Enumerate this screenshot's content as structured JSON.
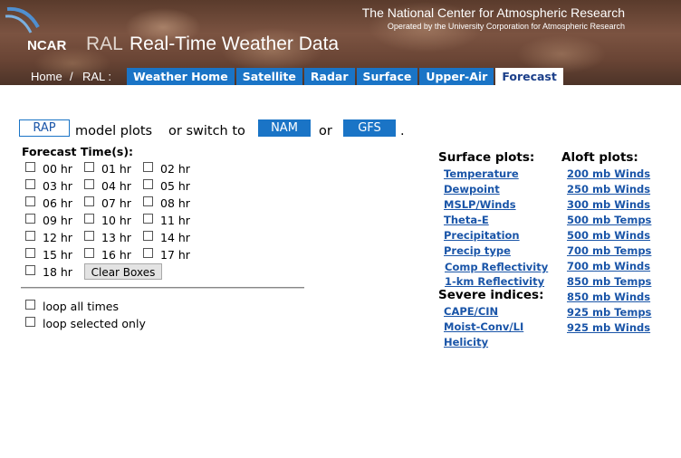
{
  "header": {
    "logo_text": "NCAR",
    "ral_text": "RAL",
    "site_title": "Real-Time Weather Data",
    "org_name": "The National Center for Atmospheric Research",
    "org_sub": "Operated by the University Corporation for Atmospheric Research",
    "breadcrumb_home": "Home",
    "breadcrumb_sep": "/",
    "breadcrumb_ral": "RAL :"
  },
  "nav": {
    "tabs": [
      {
        "label": "Weather Home"
      },
      {
        "label": "Satellite"
      },
      {
        "label": "Radar"
      },
      {
        "label": "Surface"
      },
      {
        "label": "Upper-Air"
      },
      {
        "label": "Forecast",
        "active": true
      }
    ]
  },
  "model_switch": {
    "current": "RAP",
    "text_model_plots": "model plots",
    "text_or_switch": "or switch to",
    "alt1": "NAM",
    "text_or": "or",
    "alt2": "GFS",
    "period": "."
  },
  "forecast": {
    "label": "Forecast Time(s):",
    "hours": [
      "00 hr",
      "01 hr",
      "02 hr",
      "03 hr",
      "04 hr",
      "05 hr",
      "06 hr",
      "07 hr",
      "08 hr",
      "09 hr",
      "10 hr",
      "11 hr",
      "12 hr",
      "13 hr",
      "14 hr",
      "15 hr",
      "16 hr",
      "17 hr",
      "18 hr"
    ],
    "clear_button": "Clear Boxes",
    "loop_all": "loop all times",
    "loop_selected": "loop selected only"
  },
  "surface": {
    "heading": "Surface plots:",
    "links": [
      "Temperature",
      "Dewpoint",
      "MSLP/Winds",
      "Theta-E",
      "Precipitation",
      "Precip type",
      "Comp Reflectivity",
      "1-km Reflectivity"
    ]
  },
  "severe": {
    "heading": "Severe indices:",
    "links": [
      "CAPE/CIN",
      "Moist-Conv/LI",
      "Helicity"
    ]
  },
  "aloft": {
    "heading": "Aloft plots:",
    "links": [
      "200 mb Winds",
      "250 mb Winds",
      "300 mb Winds",
      "500 mb Temps",
      "500 mb Winds",
      "700 mb Temps",
      "700 mb Winds",
      "850 mb Temps",
      "850 mb Winds",
      "925 mb Temps",
      "925 mb Winds"
    ]
  },
  "colors": {
    "nav_blue": "#1a74c6",
    "link_blue": "#1a55a8"
  }
}
